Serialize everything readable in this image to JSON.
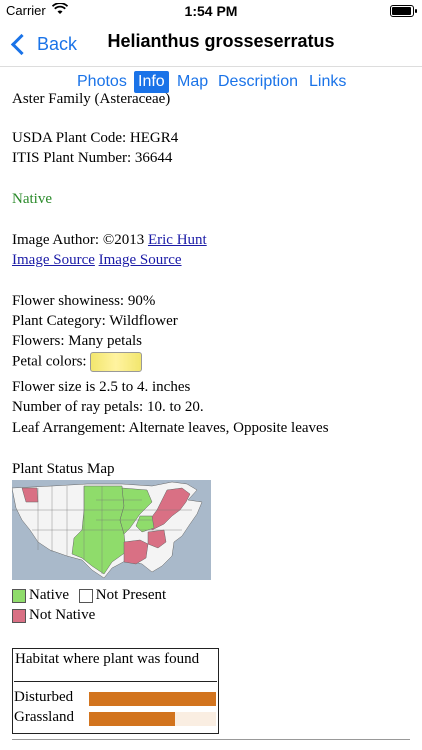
{
  "status": {
    "carrier": "Carrier",
    "time": "1:54 PM",
    "battery_level": 0.95
  },
  "nav": {
    "back_label": "Back",
    "title": "Helianthus grosseserratus"
  },
  "tabs": [
    {
      "label": "Photos",
      "active": false
    },
    {
      "label": "Info",
      "active": true
    },
    {
      "label": "Map",
      "active": false
    },
    {
      "label": "Description",
      "active": false
    },
    {
      "label": "Links",
      "active": false
    }
  ],
  "info": {
    "family": "Aster Family (Asteraceae)",
    "usda_code": "USDA Plant Code: HEGR4",
    "itis_number": "ITIS Plant Number: 36644",
    "native_status": "Native",
    "image_author_prefix": "Image Author: ©2013",
    "image_author_link": "Eric Hunt",
    "image_source_1": "Image Source",
    "image_source_2": "Image Source",
    "flower_showiness": "Flower showiness: 90%",
    "plant_category": "Plant Category: Wildflower",
    "flowers": "Flowers: Many petals",
    "petal_colors_label": "Petal colors:",
    "petal_color_hex": "#f5e97a",
    "flower_size": "Flower size is 2.5 to 4. inches",
    "ray_petals": "Number of ray petals: 10. to 20.",
    "leaf_arrangement": "Leaf Arrangement: Alternate leaves, Opposite leaves"
  },
  "status_map": {
    "title": "Plant Status Map",
    "legend": [
      {
        "label": "Native",
        "color": "#8fdc6b"
      },
      {
        "label": "Not Present",
        "color": "#ffffff"
      },
      {
        "label": "Not Native",
        "color": "#d97084"
      }
    ]
  },
  "habitat": {
    "title": "Habitat where plant was found",
    "rows": [
      {
        "label": "Disturbed",
        "fraction": 1.0
      },
      {
        "label": "Grassland",
        "fraction": 0.68
      }
    ]
  }
}
